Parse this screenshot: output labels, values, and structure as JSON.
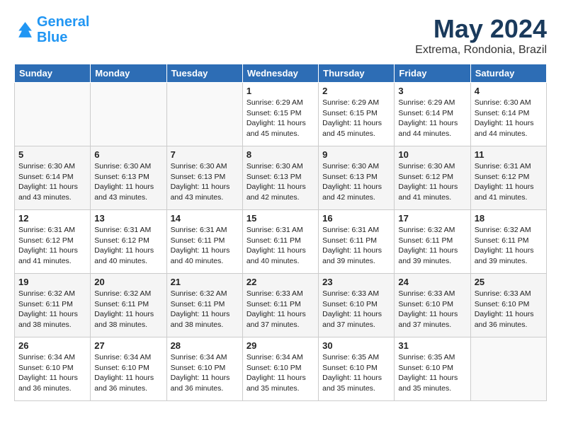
{
  "logo": {
    "line1": "General",
    "line2": "Blue"
  },
  "title": "May 2024",
  "subtitle": "Extrema, Rondonia, Brazil",
  "days_header": [
    "Sunday",
    "Monday",
    "Tuesday",
    "Wednesday",
    "Thursday",
    "Friday",
    "Saturday"
  ],
  "weeks": [
    [
      {
        "day": "",
        "info": ""
      },
      {
        "day": "",
        "info": ""
      },
      {
        "day": "",
        "info": ""
      },
      {
        "day": "1",
        "info": "Sunrise: 6:29 AM\nSunset: 6:15 PM\nDaylight: 11 hours\nand 45 minutes."
      },
      {
        "day": "2",
        "info": "Sunrise: 6:29 AM\nSunset: 6:15 PM\nDaylight: 11 hours\nand 45 minutes."
      },
      {
        "day": "3",
        "info": "Sunrise: 6:29 AM\nSunset: 6:14 PM\nDaylight: 11 hours\nand 44 minutes."
      },
      {
        "day": "4",
        "info": "Sunrise: 6:30 AM\nSunset: 6:14 PM\nDaylight: 11 hours\nand 44 minutes."
      }
    ],
    [
      {
        "day": "5",
        "info": "Sunrise: 6:30 AM\nSunset: 6:14 PM\nDaylight: 11 hours\nand 43 minutes."
      },
      {
        "day": "6",
        "info": "Sunrise: 6:30 AM\nSunset: 6:13 PM\nDaylight: 11 hours\nand 43 minutes."
      },
      {
        "day": "7",
        "info": "Sunrise: 6:30 AM\nSunset: 6:13 PM\nDaylight: 11 hours\nand 43 minutes."
      },
      {
        "day": "8",
        "info": "Sunrise: 6:30 AM\nSunset: 6:13 PM\nDaylight: 11 hours\nand 42 minutes."
      },
      {
        "day": "9",
        "info": "Sunrise: 6:30 AM\nSunset: 6:13 PM\nDaylight: 11 hours\nand 42 minutes."
      },
      {
        "day": "10",
        "info": "Sunrise: 6:30 AM\nSunset: 6:12 PM\nDaylight: 11 hours\nand 41 minutes."
      },
      {
        "day": "11",
        "info": "Sunrise: 6:31 AM\nSunset: 6:12 PM\nDaylight: 11 hours\nand 41 minutes."
      }
    ],
    [
      {
        "day": "12",
        "info": "Sunrise: 6:31 AM\nSunset: 6:12 PM\nDaylight: 11 hours\nand 41 minutes."
      },
      {
        "day": "13",
        "info": "Sunrise: 6:31 AM\nSunset: 6:12 PM\nDaylight: 11 hours\nand 40 minutes."
      },
      {
        "day": "14",
        "info": "Sunrise: 6:31 AM\nSunset: 6:11 PM\nDaylight: 11 hours\nand 40 minutes."
      },
      {
        "day": "15",
        "info": "Sunrise: 6:31 AM\nSunset: 6:11 PM\nDaylight: 11 hours\nand 40 minutes."
      },
      {
        "day": "16",
        "info": "Sunrise: 6:31 AM\nSunset: 6:11 PM\nDaylight: 11 hours\nand 39 minutes."
      },
      {
        "day": "17",
        "info": "Sunrise: 6:32 AM\nSunset: 6:11 PM\nDaylight: 11 hours\nand 39 minutes."
      },
      {
        "day": "18",
        "info": "Sunrise: 6:32 AM\nSunset: 6:11 PM\nDaylight: 11 hours\nand 39 minutes."
      }
    ],
    [
      {
        "day": "19",
        "info": "Sunrise: 6:32 AM\nSunset: 6:11 PM\nDaylight: 11 hours\nand 38 minutes."
      },
      {
        "day": "20",
        "info": "Sunrise: 6:32 AM\nSunset: 6:11 PM\nDaylight: 11 hours\nand 38 minutes."
      },
      {
        "day": "21",
        "info": "Sunrise: 6:32 AM\nSunset: 6:11 PM\nDaylight: 11 hours\nand 38 minutes."
      },
      {
        "day": "22",
        "info": "Sunrise: 6:33 AM\nSunset: 6:11 PM\nDaylight: 11 hours\nand 37 minutes."
      },
      {
        "day": "23",
        "info": "Sunrise: 6:33 AM\nSunset: 6:10 PM\nDaylight: 11 hours\nand 37 minutes."
      },
      {
        "day": "24",
        "info": "Sunrise: 6:33 AM\nSunset: 6:10 PM\nDaylight: 11 hours\nand 37 minutes."
      },
      {
        "day": "25",
        "info": "Sunrise: 6:33 AM\nSunset: 6:10 PM\nDaylight: 11 hours\nand 36 minutes."
      }
    ],
    [
      {
        "day": "26",
        "info": "Sunrise: 6:34 AM\nSunset: 6:10 PM\nDaylight: 11 hours\nand 36 minutes."
      },
      {
        "day": "27",
        "info": "Sunrise: 6:34 AM\nSunset: 6:10 PM\nDaylight: 11 hours\nand 36 minutes."
      },
      {
        "day": "28",
        "info": "Sunrise: 6:34 AM\nSunset: 6:10 PM\nDaylight: 11 hours\nand 36 minutes."
      },
      {
        "day": "29",
        "info": "Sunrise: 6:34 AM\nSunset: 6:10 PM\nDaylight: 11 hours\nand 35 minutes."
      },
      {
        "day": "30",
        "info": "Sunrise: 6:35 AM\nSunset: 6:10 PM\nDaylight: 11 hours\nand 35 minutes."
      },
      {
        "day": "31",
        "info": "Sunrise: 6:35 AM\nSunset: 6:10 PM\nDaylight: 11 hours\nand 35 minutes."
      },
      {
        "day": "",
        "info": ""
      }
    ]
  ]
}
